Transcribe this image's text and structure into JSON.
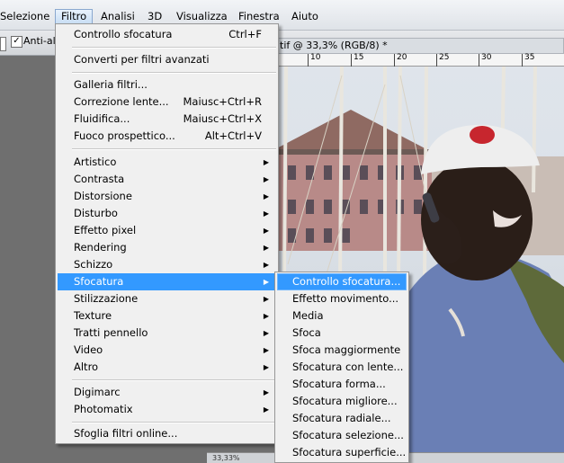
{
  "menubar": {
    "items": [
      {
        "label": "Selezione",
        "active": false
      },
      {
        "label": "Filtro",
        "active": true
      },
      {
        "label": "Analisi",
        "active": false
      },
      {
        "label": "3D",
        "active": false
      },
      {
        "label": "Visualizza",
        "active": false
      },
      {
        "label": "Finestra",
        "active": false
      },
      {
        "label": "Aiuto",
        "active": false
      }
    ]
  },
  "options_bar": {
    "anti_alias_label": "Anti-alia",
    "anti_alias_checked": true,
    "checkmark_glyph": "✓"
  },
  "document": {
    "tab_title": "tif @ 33,3% (RGB/8) *",
    "ruler_labels": [
      "10",
      "15",
      "20",
      "25",
      "30",
      "35"
    ],
    "zoom_readout": "33,33%"
  },
  "filter_menu": {
    "items": [
      {
        "label": "Controllo sfocatura",
        "shortcut": "Ctrl+F"
      },
      {
        "separator": true
      },
      {
        "label": "Converti per filtri avanzati"
      },
      {
        "separator": true
      },
      {
        "label": "Galleria filtri..."
      },
      {
        "label": "Correzione lente...",
        "shortcut": "Maiusc+Ctrl+R"
      },
      {
        "label": "Fluidifica...",
        "shortcut": "Maiusc+Ctrl+X"
      },
      {
        "label": "Fuoco prospettico...",
        "shortcut": "Alt+Ctrl+V"
      },
      {
        "separator": true
      },
      {
        "label": "Artistico",
        "submenu": true
      },
      {
        "label": "Contrasta",
        "submenu": true
      },
      {
        "label": "Distorsione",
        "submenu": true
      },
      {
        "label": "Disturbo",
        "submenu": true
      },
      {
        "label": "Effetto pixel",
        "submenu": true
      },
      {
        "label": "Rendering",
        "submenu": true
      },
      {
        "label": "Schizzo",
        "submenu": true
      },
      {
        "label": "Sfocatura",
        "submenu": true,
        "highlighted": true
      },
      {
        "label": "Stilizzazione",
        "submenu": true
      },
      {
        "label": "Texture",
        "submenu": true
      },
      {
        "label": "Tratti pennello",
        "submenu": true
      },
      {
        "label": "Video",
        "submenu": true
      },
      {
        "label": "Altro",
        "submenu": true
      },
      {
        "separator": true
      },
      {
        "label": "Digimarc",
        "submenu": true
      },
      {
        "label": "Photomatix",
        "submenu": true
      },
      {
        "separator": true
      },
      {
        "label": "Sfoglia filtri online..."
      }
    ],
    "submenu_arrow": "▶"
  },
  "blur_submenu": {
    "items": [
      {
        "label": "Controllo sfocatura...",
        "highlighted": true
      },
      {
        "label": "Effetto movimento..."
      },
      {
        "label": "Media"
      },
      {
        "label": "Sfoca"
      },
      {
        "label": "Sfoca maggiormente"
      },
      {
        "label": "Sfocatura con lente..."
      },
      {
        "label": "Sfocatura forma..."
      },
      {
        "label": "Sfocatura migliore..."
      },
      {
        "label": "Sfocatura radiale..."
      },
      {
        "label": "Sfocatura selezione..."
      },
      {
        "label": "Sfocatura superficie..."
      }
    ]
  },
  "colors": {
    "highlight": "#3399ff",
    "menu_background": "#f0f0f0",
    "workspace": "#6f6f6f"
  }
}
